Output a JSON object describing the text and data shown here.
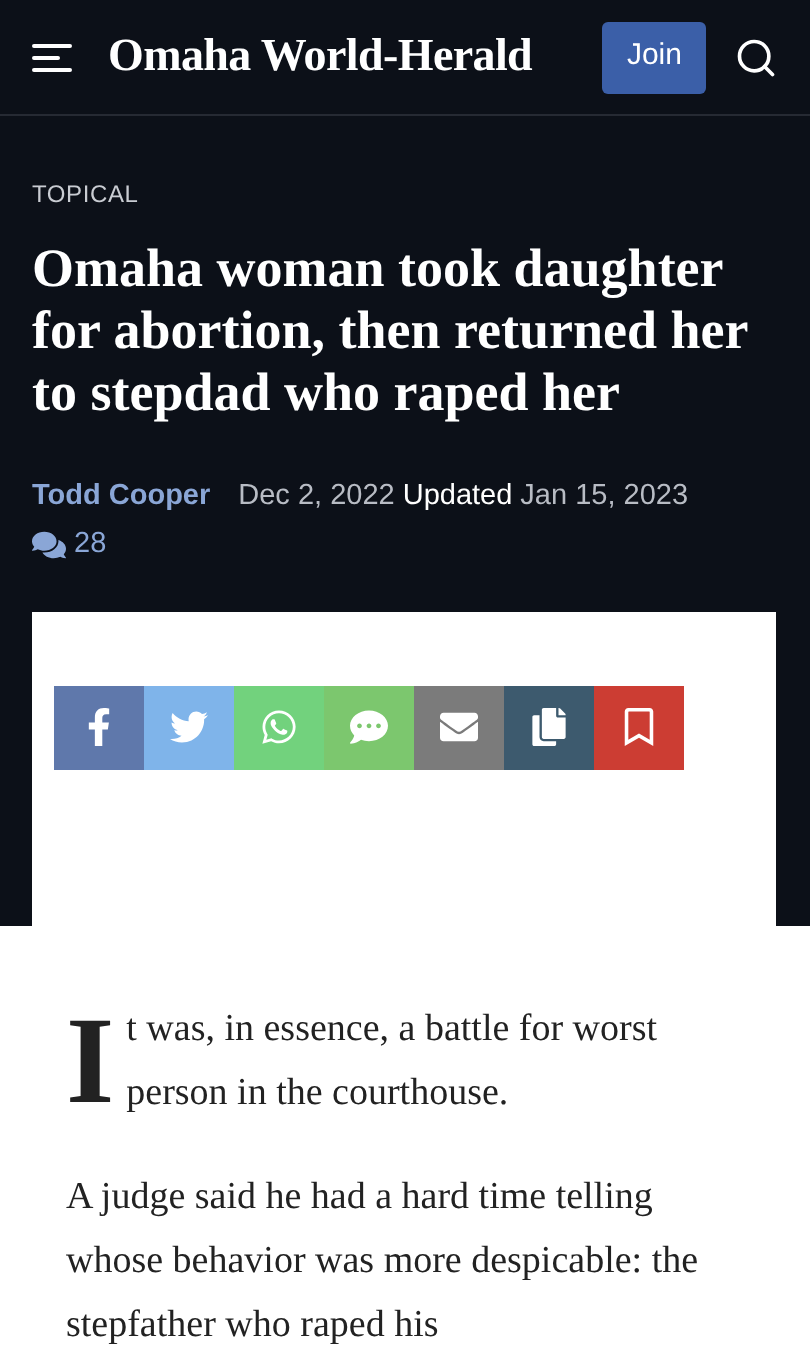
{
  "header": {
    "logo": "Omaha World-Herald",
    "join_button": "Join"
  },
  "article": {
    "section": "TOPICAL",
    "headline": "Omaha woman took daughter for abortion, then returned her to stepdad who raped her",
    "author": "Todd Cooper",
    "published": "Dec 2, 2022",
    "updated_label": "Updated",
    "updated": "Jan 15, 2023",
    "comments": "28"
  },
  "share_buttons": [
    {
      "kind": "facebook",
      "color": "#5f78ab"
    },
    {
      "kind": "twitter",
      "color": "#7fb4ea"
    },
    {
      "kind": "whatsapp",
      "color": "#72d27d"
    },
    {
      "kind": "sms",
      "color": "#7cc76e"
    },
    {
      "kind": "email",
      "color": "#7b7b7b"
    },
    {
      "kind": "copy",
      "color": "#3d5a6e"
    },
    {
      "kind": "bookmark",
      "color": "#cc3d33"
    }
  ],
  "body": {
    "drop_cap": "I",
    "first_paragraph": "t was, in essence, a battle for worst person in the courthouse.",
    "paragraphs": [
      "A judge said he had a hard time telling whose behavior was more despicable: the stepfather who raped his"
    ]
  }
}
